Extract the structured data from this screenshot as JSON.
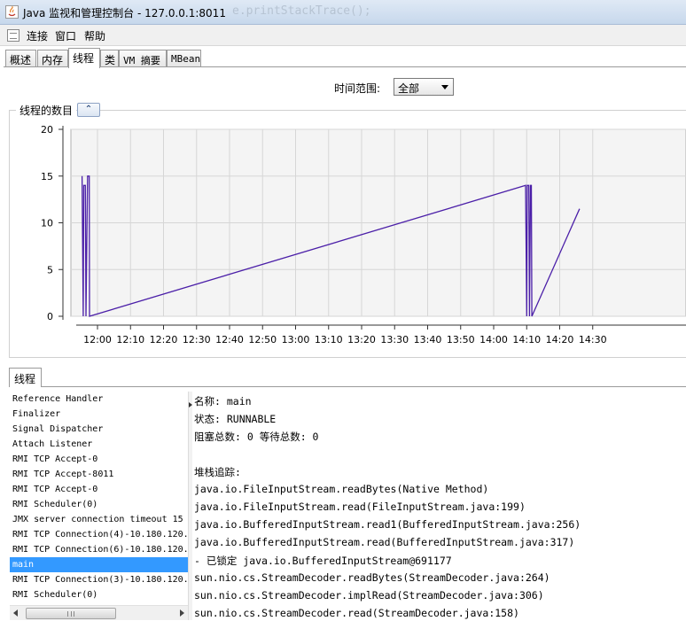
{
  "window": {
    "title": "Java 监视和管理控制台 - 127.0.0.1:8011",
    "background_code": "e.printStackTrace();"
  },
  "menu": [
    "连接",
    "窗口",
    "帮助"
  ],
  "tabs": [
    {
      "label": "概述",
      "active": false
    },
    {
      "label": "内存",
      "active": false
    },
    {
      "label": "线程",
      "active": true
    },
    {
      "label": "类",
      "active": false
    },
    {
      "label": "VM 摘要",
      "active": false
    },
    {
      "label": "MBean",
      "active": false
    }
  ],
  "time_range": {
    "label": "时间范围:",
    "selected": "全部"
  },
  "chart_section": {
    "title": "线程的数目",
    "collapse_icon": "double-chevron-up-icon"
  },
  "chart_data": {
    "type": "line",
    "title": "线程的数目",
    "ylim": [
      0,
      20
    ],
    "yticks": [
      "0",
      "5",
      "10",
      "15",
      "20"
    ],
    "xticks": [
      "12:00",
      "12:10",
      "12:20",
      "12:30",
      "12:40",
      "12:50",
      "13:00",
      "13:10",
      "13:20",
      "13:30",
      "13:40",
      "13:50",
      "14:00",
      "14:10",
      "14:20",
      "14:30"
    ],
    "grid": true,
    "line_color": "#4b1fa8",
    "series": [
      {
        "points": [
          [
            "11:55:20",
            15
          ],
          [
            "11:55:40",
            0
          ],
          [
            "11:55:50",
            14
          ],
          [
            "11:56:20",
            14
          ],
          [
            "11:56:30",
            0
          ],
          [
            "11:57:00",
            15
          ],
          [
            "11:57:30",
            15
          ],
          [
            "11:57:35",
            0
          ],
          [
            "14:09:40",
            14
          ],
          [
            "14:10:00",
            0
          ],
          [
            "14:10:10",
            14
          ],
          [
            "14:10:40",
            14
          ],
          [
            "14:10:50",
            0
          ],
          [
            "14:11:10",
            14
          ],
          [
            "14:11:25",
            14
          ],
          [
            "14:11:35",
            0
          ],
          [
            "14:26:00",
            11.5
          ]
        ]
      }
    ]
  },
  "threads_panel": {
    "tab_label": "线程",
    "selected_index": 11,
    "threads": [
      "Reference Handler",
      "Finalizer",
      "Signal Dispatcher",
      "Attach Listener",
      "RMI TCP Accept-0",
      "RMI TCP Accept-8011",
      "RMI TCP Accept-0",
      "RMI Scheduler(0)",
      "JMX server connection timeout 15",
      "RMI TCP Connection(4)-10.180.120.",
      "RMI TCP Connection(6)-10.180.120.",
      "main",
      "RMI TCP Connection(3)-10.180.120.",
      "RMI Scheduler(0)"
    ]
  },
  "thread_detail": {
    "name_line": "名称: main",
    "state_line": "状态: RUNNABLE",
    "counts_line": "阻塞总数: 0  等待总数: 0",
    "stack_header": "堆栈追踪:",
    "stack": [
      "java.io.FileInputStream.readBytes(Native Method)",
      "java.io.FileInputStream.read(FileInputStream.java:199)",
      "java.io.BufferedInputStream.read1(BufferedInputStream.java:256)",
      "java.io.BufferedInputStream.read(BufferedInputStream.java:317)",
      "  - 已锁定 java.io.BufferedInputStream@691177",
      "sun.nio.cs.StreamDecoder.readBytes(StreamDecoder.java:264)",
      "sun.nio.cs.StreamDecoder.implRead(StreamDecoder.java:306)",
      "sun.nio.cs.StreamDecoder.read(StreamDecoder.java:158)"
    ]
  }
}
